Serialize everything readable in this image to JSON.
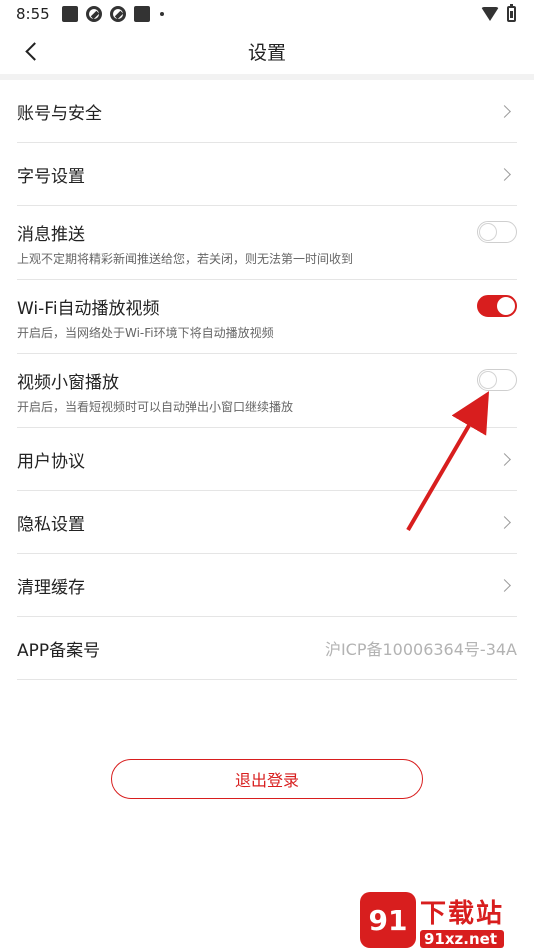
{
  "status_bar": {
    "time": "8:55"
  },
  "nav": {
    "title": "设置"
  },
  "settings": [
    {
      "label": "账号与安全"
    },
    {
      "label": "字号设置"
    },
    {
      "label": "消息推送",
      "description": "上观不定期将精彩新闻推送给您，若关闭，则无法第一时间收到",
      "toggle": false
    },
    {
      "label": "Wi-Fi自动播放视频",
      "description": "开启后，当网络处于Wi-Fi环境下将自动播放视频",
      "toggle": true
    },
    {
      "label": "视频小窗播放",
      "description": "开启后，当看短视频时可以自动弹出小窗口继续播放",
      "toggle": false
    },
    {
      "label": "用户协议"
    },
    {
      "label": "隐私设置"
    },
    {
      "label": "清理缓存"
    },
    {
      "label": "APP备案号",
      "value": "沪ICP备10006364号-34A"
    }
  ],
  "logout": {
    "label": "退出登录"
  },
  "watermark": {
    "logo": "91",
    "title": "下载站",
    "url": "91xz.net"
  },
  "colors": {
    "accent": "#d81e1e",
    "divider": "#e5e5e5",
    "annotation_arrow": "#d81e1e"
  }
}
